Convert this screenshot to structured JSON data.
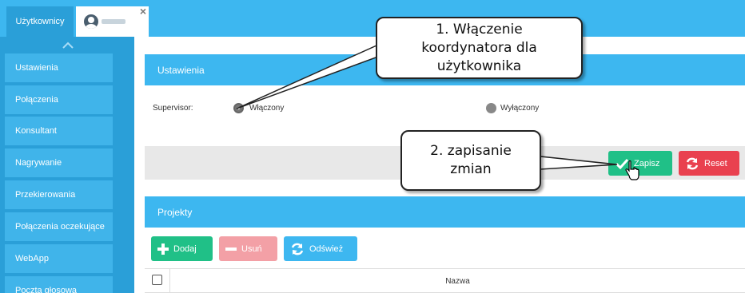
{
  "tabs": {
    "users_label": "Użytkownicy",
    "close_symbol": "×"
  },
  "sidebar": {
    "items": [
      {
        "label": "Ustawienia"
      },
      {
        "label": "Połączenia"
      },
      {
        "label": "Konsultant"
      },
      {
        "label": "Nagrywanie"
      },
      {
        "label": "Przekierowania"
      },
      {
        "label": "Połączenia oczekujące"
      },
      {
        "label": "WebApp"
      },
      {
        "label": "Poczta głosowa"
      }
    ]
  },
  "settings": {
    "header": "Ustawienia",
    "supervisor_label": "Supervisor:",
    "option_on": "Włączony",
    "option_off": "Wyłączony",
    "selected": "Włączony"
  },
  "actions": {
    "save_label": "Zapisz",
    "reset_label": "Reset"
  },
  "projects": {
    "header": "Projekty",
    "add_label": "Dodaj",
    "delete_label": "Usuń",
    "refresh_label": "Odśwież",
    "columns": [
      "Nazwa"
    ]
  },
  "annotations": {
    "callout_1": [
      "1. Włączenie",
      "koordynatora dla",
      "użytkownika"
    ],
    "callout_2": [
      "2. zapisanie",
      "zmian"
    ]
  },
  "colors": {
    "accent_blue": "#3db7f0",
    "sidebar_blue": "#2a9fd8",
    "success_green": "#20c087",
    "danger_red": "#e9414f"
  }
}
